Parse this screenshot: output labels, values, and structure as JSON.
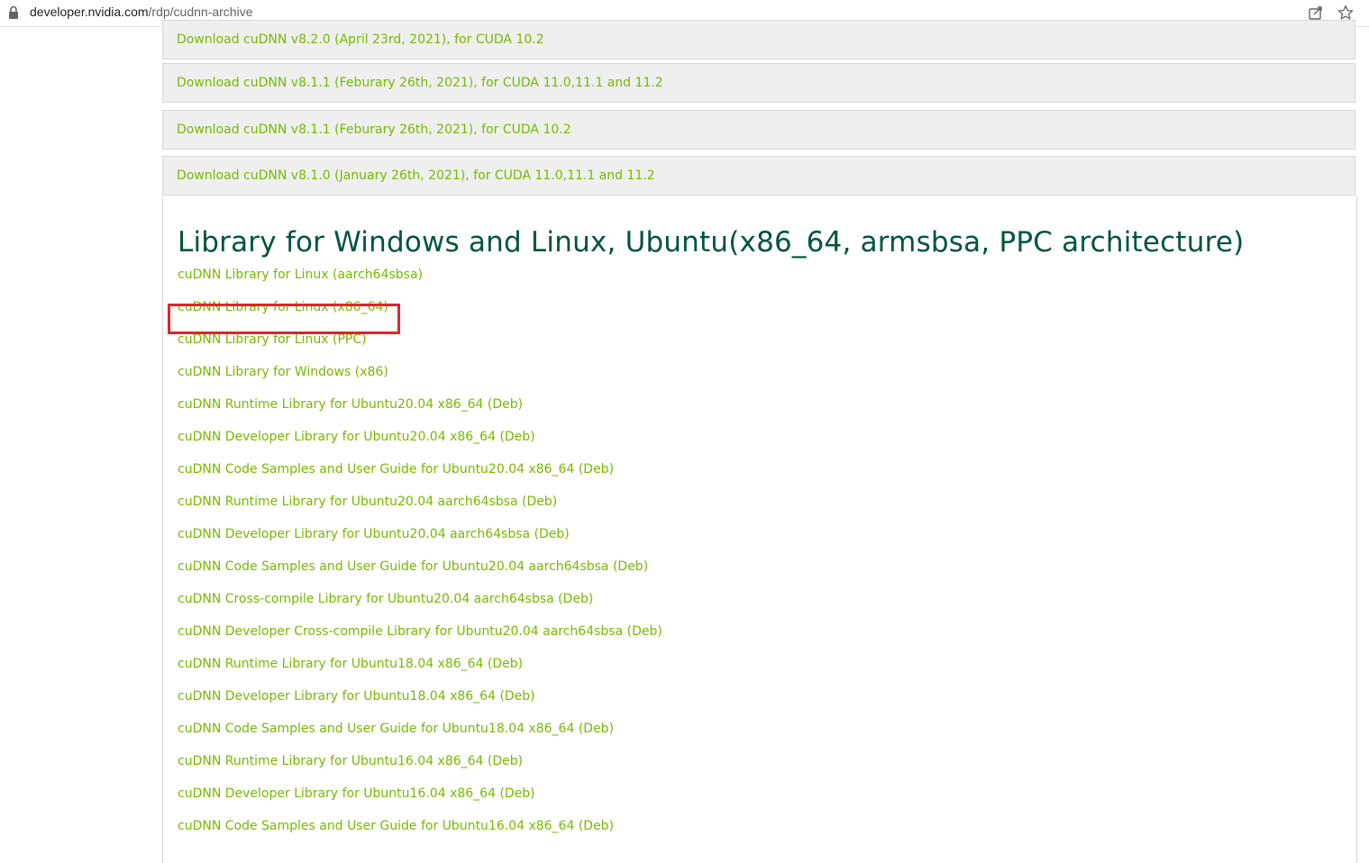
{
  "browser": {
    "url_host": "developer.nvidia.com",
    "url_path": "/rdp/cudnn-archive",
    "icons": [
      "lock-icon",
      "share-icon",
      "star-icon"
    ]
  },
  "colors": {
    "link": "#76b900",
    "heading": "#00543f",
    "highlight": "#e0242a",
    "accordion_bg": "#efefef"
  },
  "downloads": [
    {
      "label": "Download cuDNN v8.2.0 (April 23rd, 2021), for CUDA 10.2"
    },
    {
      "label": "Download cuDNN v8.1.1 (Feburary 26th, 2021), for CUDA 11.0,11.1 and 11.2"
    },
    {
      "label": "Download cuDNN v8.1.1 (Feburary 26th, 2021), for CUDA 10.2"
    },
    {
      "label": "Download cuDNN v8.1.0 (January 26th, 2021), for CUDA 11.0,11.1 and 11.2"
    }
  ],
  "library": {
    "heading": "Library for Windows and Linux, Ubuntu(x86_64, armsbsa, PPC architecture)",
    "highlighted_item": "cuDNN Library for Linux (x86_64)",
    "items": [
      "cuDNN Library for Linux (aarch64sbsa)",
      "cuDNN Library for Linux (x86_64)",
      "cuDNN Library for Linux (PPC)",
      "cuDNN Library for Windows (x86)",
      "cuDNN Runtime Library for Ubuntu20.04 x86_64 (Deb)",
      "cuDNN Developer Library for Ubuntu20.04 x86_64 (Deb)",
      "cuDNN Code Samples and User Guide for Ubuntu20.04 x86_64 (Deb)",
      "cuDNN Runtime Library for Ubuntu20.04 aarch64sbsa (Deb)",
      "cuDNN Developer Library for Ubuntu20.04 aarch64sbsa (Deb)",
      "cuDNN Code Samples and User Guide for Ubuntu20.04 aarch64sbsa (Deb)",
      "cuDNN Cross-compile Library for Ubuntu20.04 aarch64sbsa (Deb)",
      "cuDNN Developer Cross-compile Library for Ubuntu20.04 aarch64sbsa (Deb)",
      "cuDNN Runtime Library for Ubuntu18.04 x86_64 (Deb)",
      "cuDNN Developer Library for Ubuntu18.04 x86_64 (Deb)",
      "cuDNN Code Samples and User Guide for Ubuntu18.04 x86_64 (Deb)",
      "cuDNN Runtime Library for Ubuntu16.04 x86_64 (Deb)",
      "cuDNN Developer Library for Ubuntu16.04 x86_64 (Deb)",
      "cuDNN Code Samples and User Guide for Ubuntu16.04 x86_64 (Deb)"
    ]
  }
}
